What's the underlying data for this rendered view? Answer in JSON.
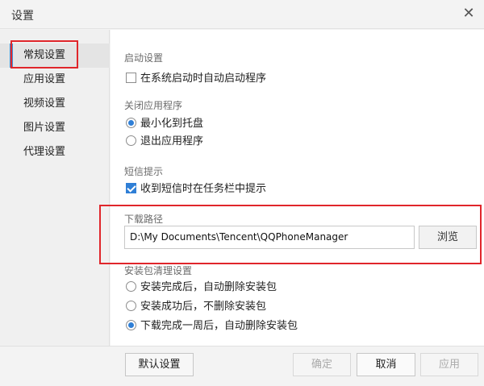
{
  "window": {
    "title": "设置",
    "close_icon": "close-icon"
  },
  "sidebar": {
    "items": [
      {
        "label": "常规设置",
        "active": true
      },
      {
        "label": "应用设置",
        "active": false
      },
      {
        "label": "视频设置",
        "active": false
      },
      {
        "label": "图片设置",
        "active": false
      },
      {
        "label": "代理设置",
        "active": false
      }
    ]
  },
  "startup": {
    "title": "启动设置",
    "auto_start": {
      "label": "在系统启动时自动启动程序",
      "checked": false
    }
  },
  "close_app": {
    "title": "关闭应用程序",
    "options": [
      {
        "label": "最小化到托盘",
        "selected": true
      },
      {
        "label": "退出应用程序",
        "selected": false
      }
    ]
  },
  "sms": {
    "title": "短信提示",
    "taskbar_notify": {
      "label": "收到短信时在任务栏中提示",
      "checked": true
    }
  },
  "download": {
    "title": "下载路径",
    "path_value": "D:\\My Documents\\Tencent\\QQPhoneManager",
    "browse_label": "浏览"
  },
  "cleanup": {
    "title": "安装包清理设置",
    "options": [
      {
        "label": "安装完成后，自动删除安装包",
        "selected": false
      },
      {
        "label": "安装成功后，不删除安装包",
        "selected": false
      },
      {
        "label": "下载完成一周后，自动删除安装包",
        "selected": true
      }
    ]
  },
  "footer": {
    "default_label": "默认设置",
    "ok_label": "确定",
    "cancel_label": "取消",
    "apply_label": "应用"
  },
  "colors": {
    "accent": "#2f7fd6",
    "highlight": "#e0262b"
  }
}
